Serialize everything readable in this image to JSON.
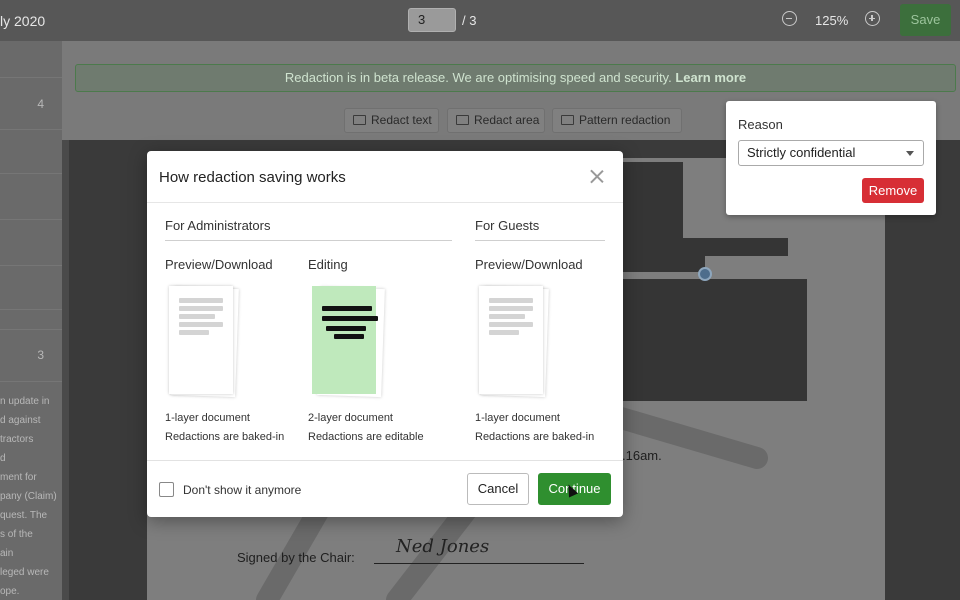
{
  "topbar": {
    "doc_title": "ly 2020",
    "page_current": "3",
    "page_total": "/ 3",
    "zoom": "125%",
    "save_label": "Save"
  },
  "left_panel": {
    "numbers": [
      "4",
      "3"
    ],
    "snippet_lines": [
      "n update in",
      "d against",
      "tractors",
      "d",
      "ment for",
      "pany (Claim)",
      "quest. The",
      "s of the",
      "ain",
      "leged were",
      "ope."
    ]
  },
  "banner": {
    "text": "Redaction is in beta release. We are optimising speed and security. ",
    "link": "Learn more"
  },
  "toolbar": {
    "redact_text": "Redact text",
    "redact_area": "Redact area",
    "pattern_redaction": "Pattern redaction"
  },
  "document": {
    "time_fragment": ".16am.",
    "signed_label": "Signed by the Chair:",
    "signature": "Ned Jones"
  },
  "reason_popover": {
    "label": "Reason",
    "selected": "Strictly confidential",
    "remove_label": "Remove"
  },
  "modal": {
    "title": "How redaction saving works",
    "admins_title": "For Administrators",
    "guests_title": "For Guests",
    "columns": [
      {
        "title": "Preview/Download",
        "line1": "1-layer document",
        "line2": "Redactions are baked-in"
      },
      {
        "title": "Editing",
        "line1": "2-layer document",
        "line2": "Redactions are editable"
      },
      {
        "title": "Preview/Download",
        "line1": "1-layer document",
        "line2": "Redactions are baked-in"
      }
    ],
    "dont_show": "Don't show it anymore",
    "cancel_label": "Cancel",
    "continue_label": "Continue"
  },
  "colors": {
    "accent_green": "#2f8f2f",
    "remove_red": "#d72e35"
  }
}
